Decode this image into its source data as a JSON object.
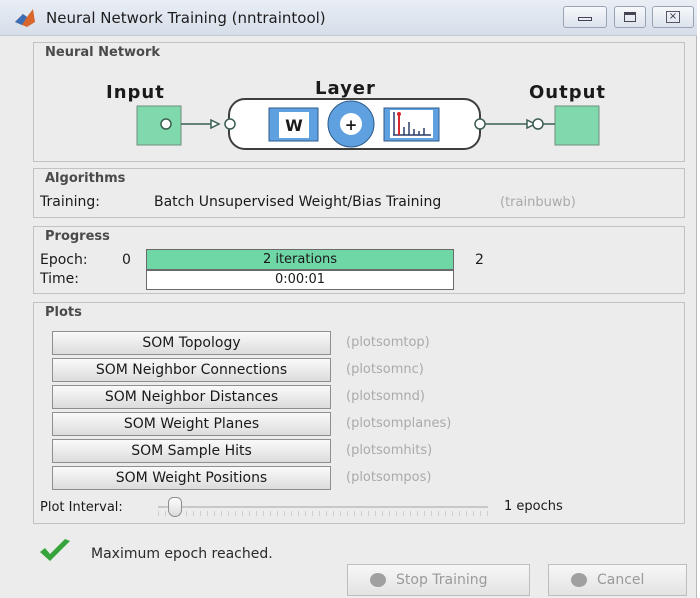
{
  "window": {
    "title": "Neural Network Training (nntraintool)"
  },
  "neural_network": {
    "section_title": "Neural Network",
    "input_label": "Input",
    "layer_label": "Layer",
    "output_label": "Output",
    "weight_symbol": "W",
    "sum_symbol": "+"
  },
  "algorithms": {
    "section_title": "Algorithms",
    "training_label": "Training:",
    "training_value": "Batch Unsupervised Weight/Bias Training",
    "training_fn": "(trainbuwb)"
  },
  "progress": {
    "section_title": "Progress",
    "epoch_label": "Epoch:",
    "epoch_start": "0",
    "epoch_bar_text": "2 iterations",
    "epoch_end": "2",
    "epoch_fraction": 1.0,
    "time_label": "Time:",
    "time_value": "0:00:01"
  },
  "plots": {
    "section_title": "Plots",
    "items": [
      {
        "label": "SOM Topology",
        "fn": "(plotsomtop)"
      },
      {
        "label": "SOM Neighbor Connections",
        "fn": "(plotsomnc)"
      },
      {
        "label": "SOM Neighbor Distances",
        "fn": "(plotsomnd)"
      },
      {
        "label": "SOM Weight Planes",
        "fn": "(plotsomplanes)"
      },
      {
        "label": "SOM Sample Hits",
        "fn": "(plotsomhits)"
      },
      {
        "label": "SOM Weight Positions",
        "fn": "(plotsompos)"
      }
    ],
    "interval_label": "Plot Interval:",
    "interval_value": "1 epochs",
    "interval_slider_fraction": 0.0
  },
  "status": {
    "message": "Maximum epoch reached."
  },
  "buttons": {
    "stop": "Stop Training",
    "cancel": "Cancel"
  },
  "colors": {
    "accent_green": "#6fd6a6",
    "check_green": "#37a33b",
    "block_green": "#7fd9ac"
  }
}
